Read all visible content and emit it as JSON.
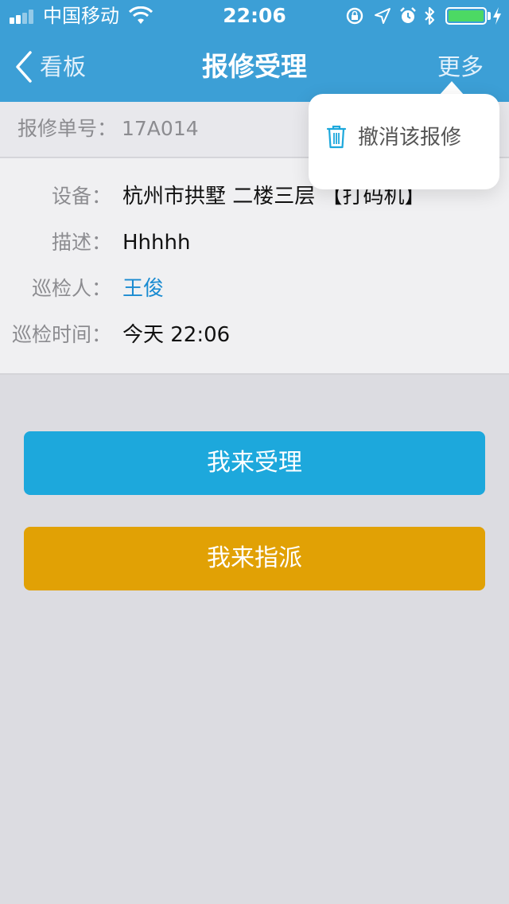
{
  "status_bar": {
    "carrier": "中国移动",
    "time": "22:06",
    "battery_level": 1.0,
    "icons": [
      "signal-icon",
      "wifi-icon",
      "rotation-lock-icon",
      "location-icon",
      "alarm-icon",
      "bluetooth-icon",
      "battery-icon",
      "charging-icon"
    ]
  },
  "nav": {
    "back_label": "看板",
    "title": "报修受理",
    "more_label": "更多"
  },
  "ticket": {
    "label": "报修单号：",
    "number": "17A014"
  },
  "details": [
    {
      "label": "设备：",
      "value": "杭州市拱墅 二楼三层 【打码机】"
    },
    {
      "label": "描述：",
      "value": "Hhhhh"
    },
    {
      "label": "巡检人：",
      "value": "王俊"
    },
    {
      "label": "巡检时间：",
      "value": "今天 22:06"
    }
  ],
  "actions": {
    "accept_label": "我来受理",
    "assign_label": "我来指派"
  },
  "popover": {
    "items": [
      {
        "label": "撤消该报修",
        "icon": "trash-icon"
      }
    ]
  },
  "colors": {
    "header": "#3c9fd6",
    "accept_button": "#1da8dc",
    "assign_button": "#e1a105",
    "link": "#1a8bd1",
    "background": "#dcdce1"
  }
}
